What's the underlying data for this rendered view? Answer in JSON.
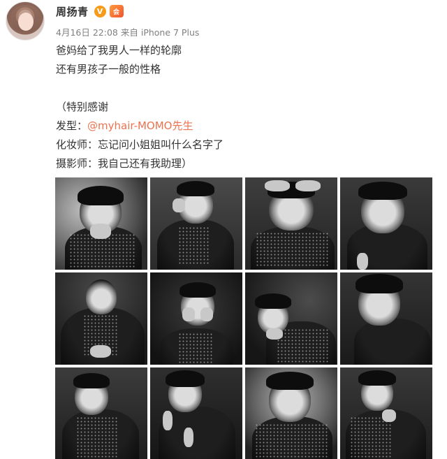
{
  "user": {
    "name": "周扬青",
    "verified_badge": "V",
    "member_badge": "会"
  },
  "meta": {
    "date": "4月16日 22:08",
    "source_prefix": "来自",
    "source_device": "iPhone 7 Plus"
  },
  "content": {
    "line1": "爸妈给了我男人一样的轮廓",
    "line2": "还有男孩子一般的性格",
    "line3": "（特别感谢",
    "hair_label": "发型：",
    "hair_mention": "@myhair-MOMO先生",
    "makeup_line": "化妆师：忘记问小姐姐叫什么名字了",
    "photo_line": "摄影师：我自己还有我助理）"
  },
  "photos": [
    {
      "label": "照片1"
    },
    {
      "label": "照片2"
    },
    {
      "label": "照片3"
    },
    {
      "label": "照片4"
    },
    {
      "label": "照片5"
    },
    {
      "label": "照片6"
    },
    {
      "label": "照片7"
    },
    {
      "label": "照片8"
    },
    {
      "label": "照片9"
    },
    {
      "label": "照片10"
    },
    {
      "label": "照片11"
    },
    {
      "label": "照片12"
    }
  ],
  "colors": {
    "link": "#eb7350",
    "meta": "#808080",
    "verified": "#f79c1a"
  }
}
